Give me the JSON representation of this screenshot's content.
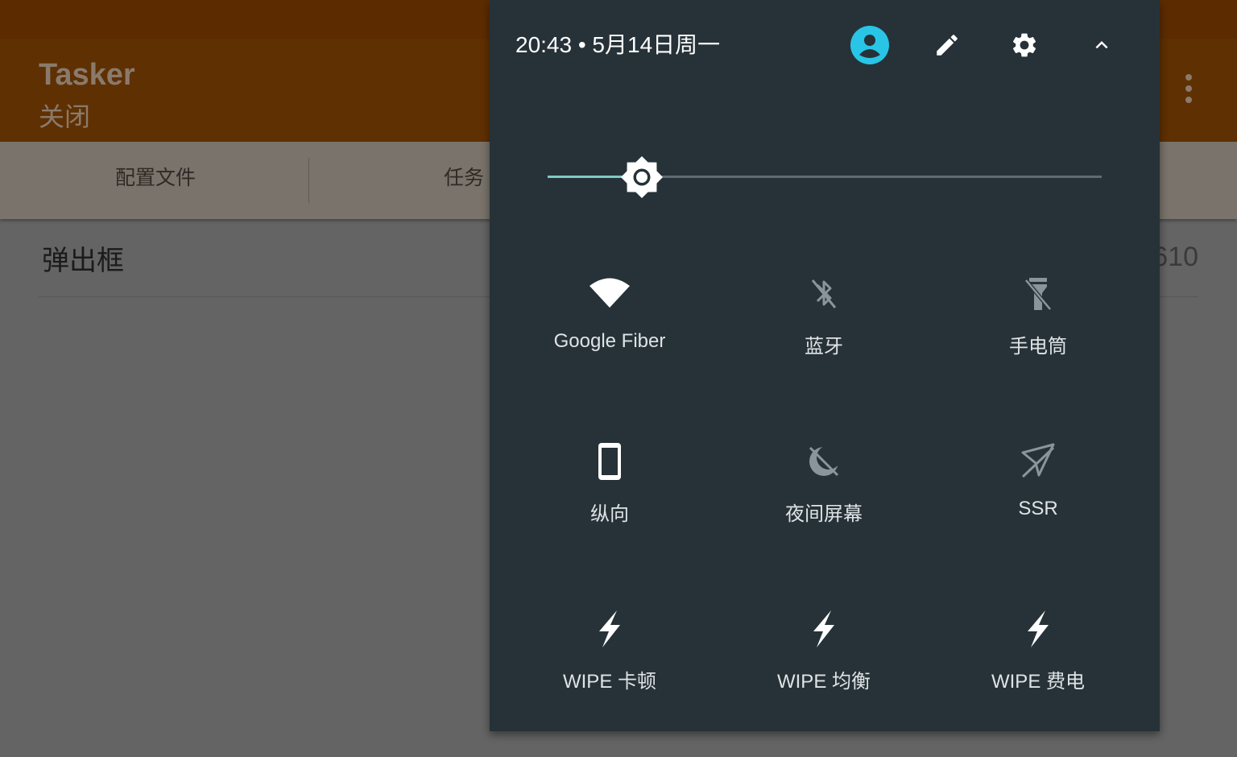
{
  "app": {
    "title": "Tasker",
    "subtitle": "关闭",
    "tabs": [
      {
        "label": "配置文件"
      },
      {
        "label": "任务"
      }
    ],
    "list_item": {
      "title": "弹出框",
      "count": "610"
    }
  },
  "quick_settings": {
    "clock": "20:43 • 5月14日周一",
    "header_icons": [
      "user-account-icon",
      "edit-pencil-icon",
      "settings-gear-icon",
      "collapse-chevron-up-icon"
    ],
    "brightness": {
      "level": 0.17
    },
    "tiles": [
      {
        "label": "Google Fiber",
        "icon": "wifi-icon",
        "active": true
      },
      {
        "label": "蓝牙",
        "icon": "bluetooth-off-icon",
        "active": false
      },
      {
        "label": "手电筒",
        "icon": "flashlight-off-icon",
        "active": false
      },
      {
        "label": "纵向",
        "icon": "portrait-phone-icon",
        "active": true
      },
      {
        "label": "夜间屏幕",
        "icon": "night-screen-off-icon",
        "active": false
      },
      {
        "label": "SSR",
        "icon": "ssr-off-icon",
        "active": false
      },
      {
        "label": "WIPE 卡顿",
        "icon": "lightning-icon",
        "active": true
      },
      {
        "label": "WIPE 均衡",
        "icon": "lightning-icon",
        "active": true
      },
      {
        "label": "WIPE 费电",
        "icon": "lightning-icon",
        "active": true
      }
    ],
    "colors": {
      "panel": "#263238",
      "accent": "#80cbc4",
      "user_icon": "#29c5e6",
      "inactive_icon": "#8a959b"
    }
  }
}
